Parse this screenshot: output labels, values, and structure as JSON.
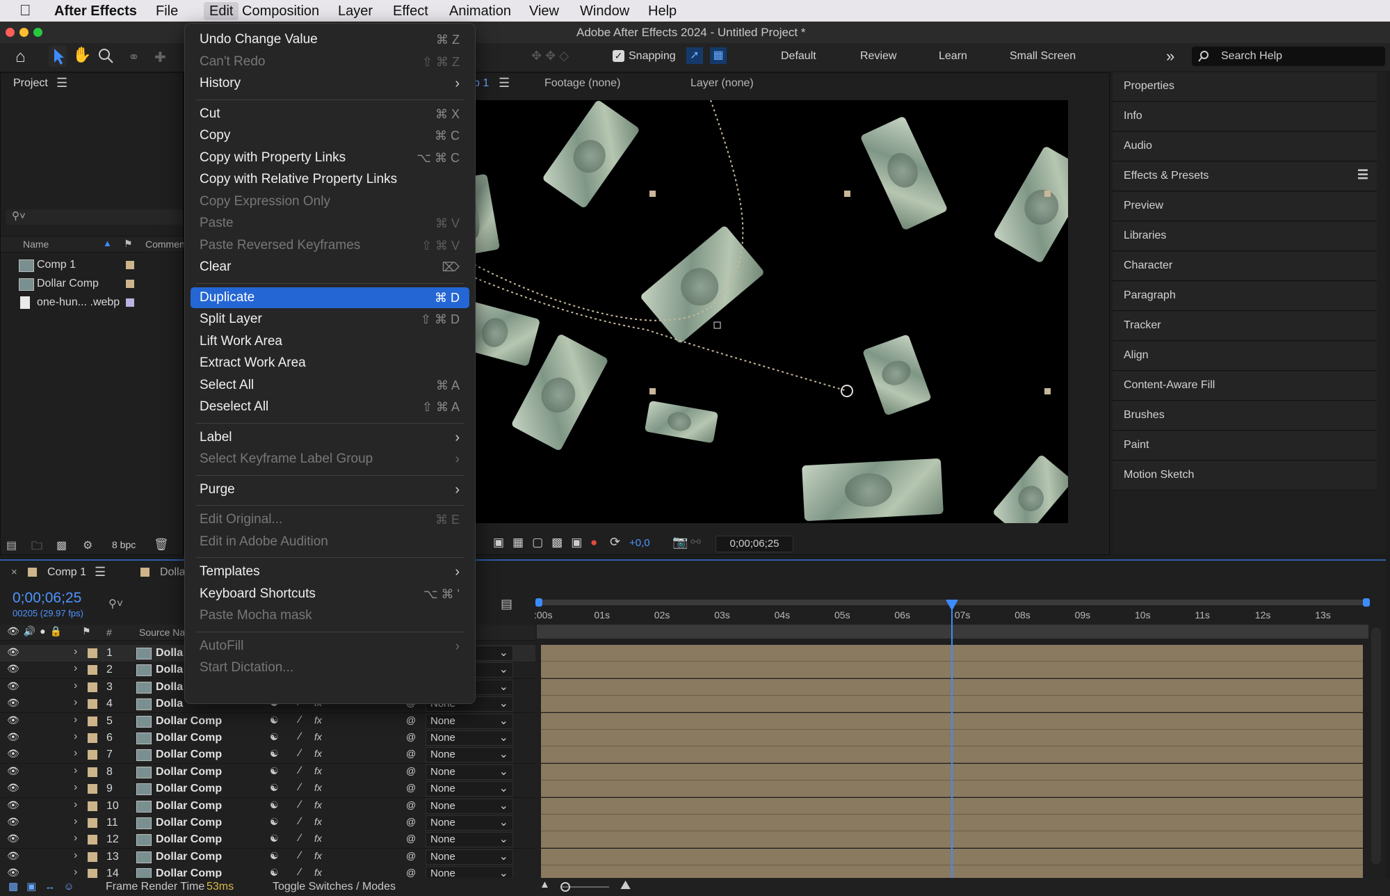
{
  "menubar": {
    "items": [
      "After Effects",
      "File",
      "Edit",
      "Composition",
      "Layer",
      "Effect",
      "Animation",
      "View",
      "Window",
      "Help"
    ]
  },
  "window": {
    "title": "Adobe After Effects 2024 - Untitled Project *"
  },
  "toolbar": {
    "snapping": "Snapping",
    "workspaces": [
      "Default",
      "Review",
      "Learn",
      "Small Screen"
    ],
    "search_placeholder": "Search Help"
  },
  "project": {
    "title": "Project",
    "col_name": "Name",
    "col_comment": "Comment",
    "items": [
      {
        "name": "Comp 1",
        "color": "#cdb48a"
      },
      {
        "name": "Dollar Comp",
        "color": "#cdb48a"
      },
      {
        "name": "one-hun... .webp",
        "color": "#b8b3e0"
      }
    ],
    "bpc": "8 bpc"
  },
  "viewer": {
    "tabs": [
      "p 1",
      "Footage (none)",
      "Layer (none)"
    ],
    "sub": "p",
    "exposure": "+0,0",
    "timecode": "0;00;06;25"
  },
  "right_panels": [
    "Properties",
    "Info",
    "Audio",
    "Effects & Presets",
    "Preview",
    "Libraries",
    "Character",
    "Paragraph",
    "Tracker",
    "Align",
    "Content-Aware Fill",
    "Brushes",
    "Paint",
    "Motion Sketch"
  ],
  "edit_menu": [
    {
      "label": "Undo Change Value",
      "shortcut": "⌘ Z",
      "enabled": true
    },
    {
      "label": "Can't Redo",
      "shortcut": "⇧ ⌘ Z",
      "enabled": false
    },
    {
      "label": "History",
      "submenu": true,
      "enabled": true
    },
    {
      "sep": true
    },
    {
      "label": "Cut",
      "shortcut": "⌘ X",
      "enabled": true
    },
    {
      "label": "Copy",
      "shortcut": "⌘ C",
      "enabled": true
    },
    {
      "label": "Copy with Property Links",
      "shortcut": "⌥ ⌘ C",
      "enabled": true
    },
    {
      "label": "Copy with Relative Property Links",
      "enabled": true
    },
    {
      "label": "Copy Expression Only",
      "enabled": false
    },
    {
      "label": "Paste",
      "shortcut": "⌘ V",
      "enabled": false
    },
    {
      "label": "Paste Reversed Keyframes",
      "shortcut": "⇧ ⌘ V",
      "enabled": false
    },
    {
      "label": "Clear",
      "shortcut": "⌦",
      "enabled": true
    },
    {
      "sep": true
    },
    {
      "label": "Duplicate",
      "shortcut": "⌘ D",
      "enabled": true,
      "highlighted": true
    },
    {
      "label": "Split Layer",
      "shortcut": "⇧ ⌘ D",
      "enabled": true
    },
    {
      "label": "Lift Work Area",
      "enabled": true
    },
    {
      "label": "Extract Work Area",
      "enabled": true
    },
    {
      "label": "Select All",
      "shortcut": "⌘ A",
      "enabled": true
    },
    {
      "label": "Deselect All",
      "shortcut": "⇧ ⌘ A",
      "enabled": true
    },
    {
      "sep": true
    },
    {
      "label": "Label",
      "submenu": true,
      "enabled": true
    },
    {
      "label": "Select Keyframe Label Group",
      "submenu": true,
      "enabled": false
    },
    {
      "sep": true
    },
    {
      "label": "Purge",
      "submenu": true,
      "enabled": true
    },
    {
      "sep": true
    },
    {
      "label": "Edit Original...",
      "shortcut": "⌘ E",
      "enabled": false
    },
    {
      "label": "Edit in Adobe Audition",
      "enabled": false
    },
    {
      "sep": true
    },
    {
      "label": "Templates",
      "submenu": true,
      "enabled": true
    },
    {
      "label": "Keyboard Shortcuts",
      "shortcut": "⌥ ⌘ '",
      "enabled": true
    },
    {
      "label": "Paste Mocha mask",
      "enabled": false
    },
    {
      "sep": true
    },
    {
      "label": "AutoFill",
      "submenu": true,
      "enabled": false
    },
    {
      "label": "Start Dictation...",
      "enabled": false
    }
  ],
  "timeline": {
    "tab": "Comp 1",
    "tab2": "Dolla",
    "timecode": "0;00;06;25",
    "frame_info": "00205 (29.97 fps)",
    "col_num": "#",
    "col_source": "Source Nar",
    "parent_default": "None",
    "ruler": [
      ":00s",
      "01s",
      "02s",
      "03s",
      "04s",
      "05s",
      "06s",
      "07s",
      "08s",
      "09s",
      "10s",
      "11s",
      "12s",
      "13s"
    ],
    "playhead_seconds": 6.83,
    "layers": [
      {
        "num": "1",
        "name": "Dolla"
      },
      {
        "num": "2",
        "name": "Dolla"
      },
      {
        "num": "3",
        "name": "Dolla"
      },
      {
        "num": "4",
        "name": "Dolla"
      },
      {
        "num": "5",
        "name": "Dollar Comp"
      },
      {
        "num": "6",
        "name": "Dollar Comp"
      },
      {
        "num": "7",
        "name": "Dollar Comp"
      },
      {
        "num": "8",
        "name": "Dollar Comp"
      },
      {
        "num": "9",
        "name": "Dollar Comp"
      },
      {
        "num": "10",
        "name": "Dollar Comp"
      },
      {
        "num": "11",
        "name": "Dollar Comp"
      },
      {
        "num": "12",
        "name": "Dollar Comp"
      },
      {
        "num": "13",
        "name": "Dollar Comp"
      },
      {
        "num": "14",
        "name": "Dollar Comp"
      }
    ]
  },
  "status": {
    "frame_render_label": "Frame Render Time",
    "frame_render_value": "53ms",
    "toggle": "Toggle Switches / Modes"
  }
}
